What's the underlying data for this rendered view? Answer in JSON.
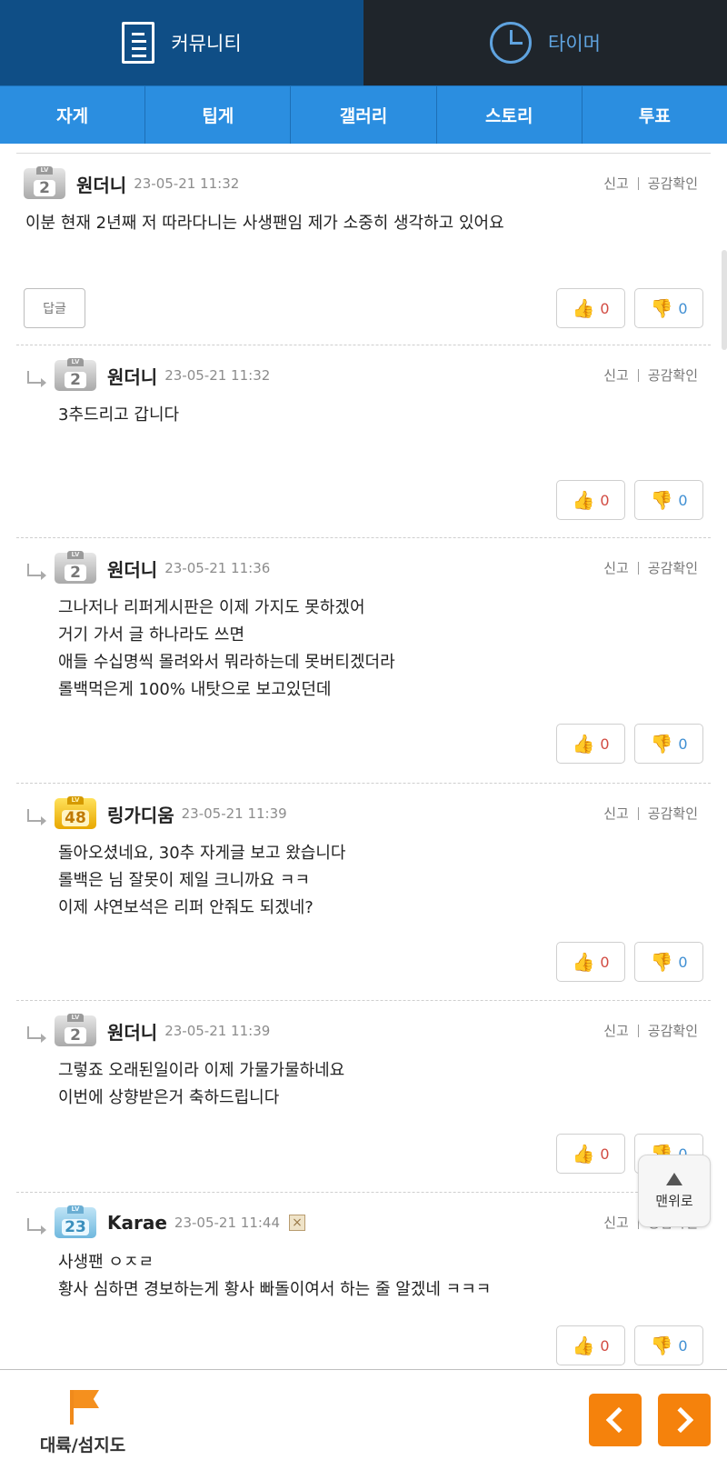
{
  "top_tabs": [
    {
      "label": "커뮤니티",
      "icon": "document-icon"
    },
    {
      "label": "타이머",
      "icon": "clock-icon"
    }
  ],
  "sub_nav": [
    "자게",
    "팁게",
    "갤러리",
    "스토리",
    "투표"
  ],
  "actions": {
    "report": "신고",
    "likes_check": "공감확인"
  },
  "reply_button": "답글",
  "comments": [
    {
      "author": "원더니",
      "level": "2",
      "level_color": "gray",
      "time": "23-05-21 11:32",
      "lines": [
        "이분 현재 2년째 저 따라다니는 사생팬임 제가 소중히 생각하고 있어요"
      ],
      "likes": "0",
      "dislikes": "0"
    },
    {
      "author": "원더니",
      "level": "2",
      "level_color": "gray",
      "time": "23-05-21 11:32",
      "lines": [
        "3추드리고 갑니다"
      ],
      "likes": "0",
      "dislikes": "0"
    },
    {
      "author": "원더니",
      "level": "2",
      "level_color": "gray",
      "time": "23-05-21 11:36",
      "lines": [
        "그나저나 리퍼게시판은 이제 가지도 못하겠어",
        "거기 가서 글 하나라도 쓰면",
        "애들 수십명씩 몰려와서 뭐라하는데 못버티겠더라",
        "롤백먹은게 100% 내탓으로 보고있던데"
      ],
      "likes": "0",
      "dislikes": "0"
    },
    {
      "author": "링가디움",
      "level": "48",
      "level_color": "yellow",
      "time": "23-05-21 11:39",
      "lines": [
        "돌아오셨네요, 30추 자게글 보고 왔습니다",
        "롤백은 님 잘못이 제일 크니까요 ㅋㅋ",
        "이제 샤연보석은 리퍼 안줘도 되겠네?"
      ],
      "likes": "0",
      "dislikes": "0"
    },
    {
      "author": "원더니",
      "level": "2",
      "level_color": "gray",
      "time": "23-05-21 11:39",
      "lines": [
        "그렇죠 오래된일이라 이제 가물가물하네요",
        "이번에 상향받은거 축하드립니다"
      ],
      "likes": "0",
      "dislikes": "0"
    },
    {
      "author": "Karae",
      "level": "23",
      "level_color": "blue",
      "time": "23-05-21 11:44",
      "lines": [
        "사생팬 ㅇㅈㄹ",
        "황사 심하면 경보하는게 황사 빠돌이여서 하는 줄 알겠네 ㅋㅋㅋ"
      ],
      "likes": "0",
      "dislikes": "0"
    }
  ],
  "to_top": "맨위로",
  "bottom": {
    "map_label": "대륙/섬지도"
  },
  "colors": {
    "header_blue": "#0f4e86",
    "header_dark": "#1f252b",
    "subnav_blue": "#2b8ee0",
    "accent_orange": "#f5820c"
  }
}
